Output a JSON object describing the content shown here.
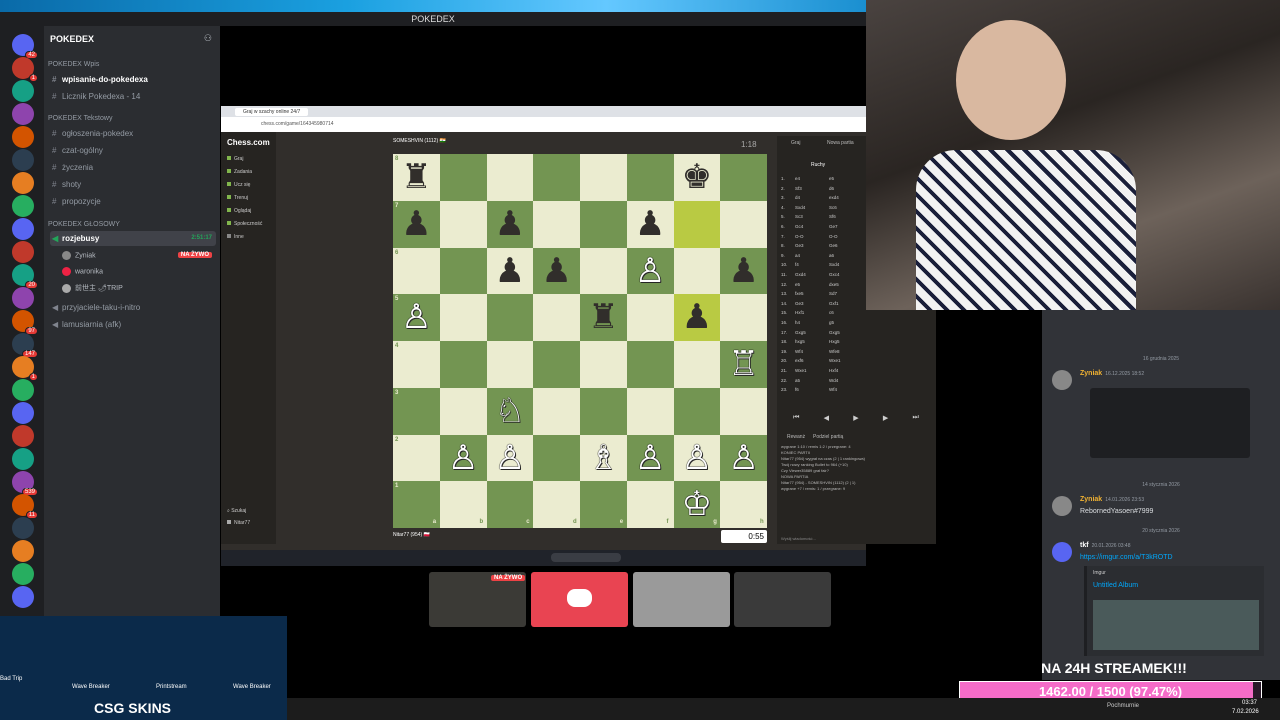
{
  "discord": {
    "window_title": "POKEDEX",
    "server_name": "POKEDEX",
    "categories": [
      "POKEDEX Wpis",
      "POKEDEX Tekstowy",
      "POKEDEX GŁOSOWY"
    ],
    "text_channels_wpis": [
      "wpisanie-do-pokedexa",
      "Licznik Pokedexa - 14"
    ],
    "text_channels": [
      "ogłoszenia-pokedex",
      "czat-ogólny",
      "życzenia",
      "shoty",
      "propozycje"
    ],
    "voice_channel": "rozjebusy",
    "voice_time": "2:51:17",
    "voice_users": [
      {
        "name": "Zyniak",
        "live": "NA ŻYWO"
      },
      {
        "name": "waronika",
        "live": ""
      },
      {
        "name": "前世主 🌶TRIP",
        "live": ""
      }
    ],
    "other_voice": [
      "przyjaciele-taku-i-nitro",
      "lamusiarnia (afk)"
    ],
    "server_badges": [
      "42",
      "1",
      "",
      "",
      "",
      "",
      "",
      "",
      "",
      "",
      "20",
      "",
      "97",
      "147",
      "1",
      "",
      "",
      "",
      "",
      "539",
      "11",
      "",
      "",
      "",
      ""
    ]
  },
  "browser": {
    "tab_title": "Graj w szachy online 24/7",
    "url": "chess.com/game/164345980714"
  },
  "chess": {
    "site": "Chess.com",
    "nav": [
      "Graj",
      "Zadania",
      "Ucz się",
      "Trenuj",
      "Oglądaj",
      "Społeczność",
      "Inne"
    ],
    "search": "Szukaj",
    "user": "Nitar77",
    "opponent": "SOMESHVIN (1112) 🇮🇳",
    "opponent_clock": "1:18",
    "player": "Nitar77 (954) 🇵🇱",
    "player_clock": "0:55",
    "panel_tabs": [
      "Graj",
      "Nowa partia"
    ],
    "moves_tab": "Ruchy",
    "board_files": [
      "a",
      "b",
      "c",
      "d",
      "e",
      "f",
      "g",
      "h"
    ],
    "board_ranks": [
      "8",
      "7",
      "6",
      "5",
      "4",
      "3",
      "2",
      "1"
    ],
    "moves": [
      [
        "1.",
        "e4",
        "e5"
      ],
      [
        "2.",
        "Sf3",
        "d6"
      ],
      [
        "3.",
        "d4",
        "exd4"
      ],
      [
        "4.",
        "Sxd4",
        "Sc6"
      ],
      [
        "5.",
        "Sc3",
        "Sf6"
      ],
      [
        "6.",
        "Gc4",
        "Ge7"
      ],
      [
        "7.",
        "O-O",
        "O-O"
      ],
      [
        "8.",
        "Ge3",
        "Ge6"
      ],
      [
        "9.",
        "a4",
        "a6"
      ],
      [
        "10.",
        "f4",
        "Sxd4"
      ],
      [
        "11.",
        "Gxd4",
        "Gxc4"
      ],
      [
        "12.",
        "e5",
        "dxe5"
      ],
      [
        "13.",
        "fxe5",
        "Sd7"
      ],
      [
        "14.",
        "Ge3",
        "Gxf1"
      ],
      [
        "15.",
        "Hxf1",
        "c6"
      ],
      [
        "16.",
        "h4",
        "g5"
      ],
      [
        "17.",
        "Gxg5",
        "Gxg5"
      ],
      [
        "18.",
        "hxg5",
        "Hxg5"
      ],
      [
        "19.",
        "Wf4",
        "Wfe8"
      ],
      [
        "20.",
        "exf6",
        "Wxe1"
      ],
      [
        "21.",
        "Wxe1",
        "Hxf4"
      ],
      [
        "22.",
        "a5",
        "Wd4"
      ],
      [
        "23.",
        "f6",
        "Wf4"
      ]
    ],
    "rematch": "Rewanż",
    "new_game": "Podziel partią",
    "log": [
      "wygrane 1:10 / remis 1:2 / przegrane: 4",
      "KONIEC PARTII",
      "Nitar77 (954) wygrał na czas (2 | 1 rankingowa)",
      "Twój nowy ranking Bullet to 964 (+10)",
      "Czy Viewer35889 grał fair?",
      "NOWA PARTIA",
      "Nitar77 (954) - SOMESHVIN (1112) (2 | 1)",
      "wygrane +7 / remis: 1 / przegrane: 9"
    ],
    "chat_placeholder": "Wyślij wiadomość..."
  },
  "stream_overlay": {
    "voice_thumb_live": "NA ŻYWO",
    "goal_text": "NA 24H STREAMEK!!!",
    "goal_progress": 0.9747,
    "goal_label": "1462.00 / 1500 (97.47%)",
    "skins_brand": "CSG SKINS",
    "skins": [
      "Bad Trip",
      "Wave Breaker",
      "Printstream",
      "Wave Breaker"
    ]
  },
  "chat": {
    "date1": "16 grudnia 2025",
    "m1_user": "Zyniak",
    "m1_time": "16.12.2025 18:52",
    "date2": "14 stycznia 2026",
    "m2_user": "Zyniak",
    "m2_time": "14.01.2026 23:53",
    "m2_text": "RebornedYasoen#7999",
    "date3": "20 stycznia 2026",
    "m3_user": "tkf",
    "m3_time": "20.01.2026 03:48",
    "m3_link": "https://imgur.com/a/T3kROTD",
    "embed_site": "Imgur",
    "embed_title": "Untitled Album"
  },
  "taskbar": {
    "weather": "Pochmurnie",
    "time": "03:37",
    "date": "7.02.2026"
  }
}
